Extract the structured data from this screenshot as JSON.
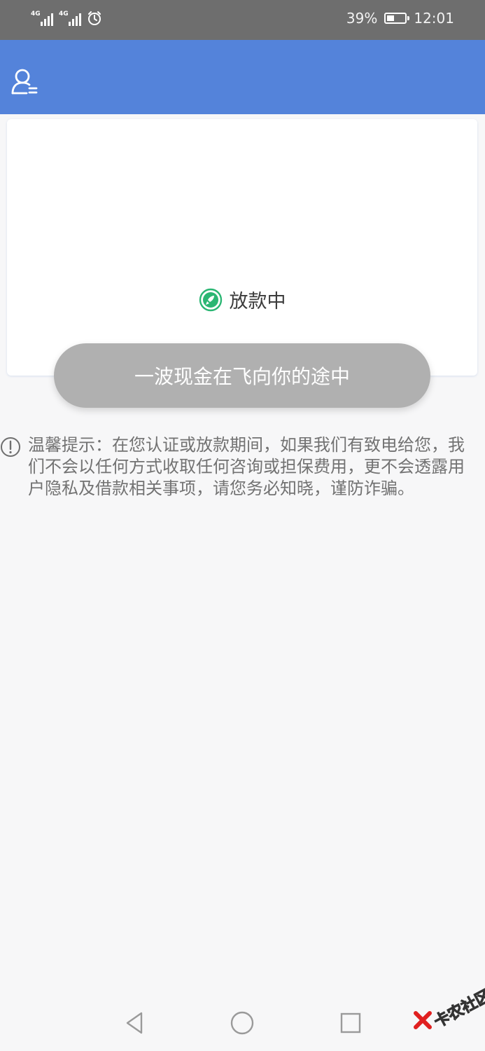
{
  "status_bar": {
    "signal_1_tag": "4G",
    "signal_2_tag": "4G",
    "battery_percent": "39%",
    "time": "12:01"
  },
  "header": {
    "profile_icon": "user-profile-icon"
  },
  "loan_card": {
    "status_icon": "rocket-icon",
    "status_icon_color": "#2bb673",
    "status_text": "放款中"
  },
  "cta_button": {
    "label": "一波现金在飞向你的途中"
  },
  "notice": {
    "icon": "exclamation-circle-icon",
    "text": "温馨提示：在您认证或放款期间，如果我们有致电给您，我们不会以任何方式收取任何咨询或担保费用，更不会透露用户隐私及借款相关事项，请您务必知晓，谨防诈骗。"
  },
  "nav_bar": {
    "back_icon": "back-triangle-icon",
    "home_icon": "home-circle-icon",
    "recents_icon": "recents-square-icon"
  },
  "watermark": {
    "text": "卡农社区"
  },
  "colors": {
    "status_bar": "#6e6e6e",
    "header": "#5483da",
    "button": "#b0b0b0",
    "background": "#f7f7f8"
  }
}
